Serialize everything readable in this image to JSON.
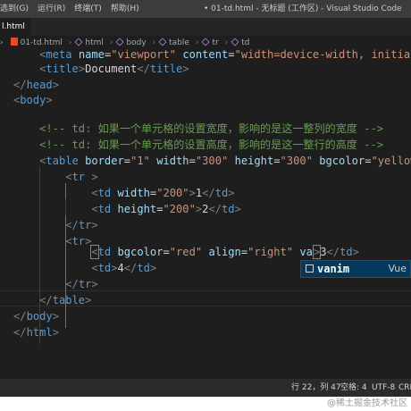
{
  "window": {
    "menu": [
      "选到(G)",
      "运行(R)",
      "终端(T)",
      "帮助(H)"
    ],
    "title": "• 01-td.html - 无标题 (工作区) - Visual Studio Code"
  },
  "tab": {
    "label": "l.html"
  },
  "breadcrumb": {
    "file": "01-td.html",
    "items": [
      "html",
      "body",
      "table",
      "tr",
      "td"
    ],
    "leading_sep": "›"
  },
  "code": {
    "l0": {
      "lead": "    ",
      "open": "<",
      "tag": "meta",
      "attr1": "name",
      "eq1": "=",
      "val1": "\"viewport\"",
      "attr2": "content",
      "eq2": "=",
      "val2": "\"width=device-width, initial-s"
    },
    "l1": {
      "lead": "    ",
      "o1": "<",
      "tag1": "title",
      "c1": ">",
      "text": "Document",
      "o2": "</",
      "tag2": "title",
      "c2": ">"
    },
    "l2": {
      "o": "</",
      "tag": "head",
      "c": ">"
    },
    "l3": {
      "o": "<",
      "tag": "body",
      "c": ">"
    },
    "l5": "    <!-- td: 如果一个单元格的设置宽度，影响的是这一整列的宽度 -->",
    "l6": "    <!-- td: 如果一个单元格的设置高度，影响的是这一整行的高度 -->",
    "l7": {
      "lead": "    ",
      "o": "<",
      "tag": "table",
      "attr1": "border",
      "eq1": "=",
      "val1": "\"1\"",
      "attr2": "width",
      "eq2": "=",
      "val2": "\"300\"",
      "attr3": "height",
      "eq3": "=",
      "val3": "\"300\"",
      "attr4": "bgcolor",
      "eq4": "=",
      "val4": "\"yellow\""
    },
    "l8": {
      "lead": "        ",
      "o": "<",
      "tag": "tr",
      "c": " >"
    },
    "l9": {
      "lead": "            ",
      "o1": "<",
      "tag1": "td",
      "attr": "width",
      "eq": "=",
      "val": "\"200\"",
      "c1": ">",
      "text": "1",
      "o2": "</",
      "tag2": "td",
      "c2": ">"
    },
    "l10": {
      "lead": "            ",
      "o1": "<",
      "tag1": "td",
      "attr": "height",
      "eq": "=",
      "val": "\"200\"",
      "c1": ">",
      "text": "2",
      "o2": "</",
      "tag2": "td",
      "c2": ">"
    },
    "l11": {
      "lead": "        ",
      "o": "</",
      "tag": "tr",
      "c": ">"
    },
    "l12": {
      "lead": "        ",
      "o": "<",
      "tag": "tr",
      "c": ">"
    },
    "l13": {
      "lead": "            ",
      "o1": "<",
      "tag1": "td",
      "attr1": "bgcolor",
      "eq1": "=",
      "val1": "\"red\"",
      "attr2": "align",
      "eq2": "=",
      "val2": "\"right\"",
      "typed": "va",
      "c1": ">",
      "text": "3",
      "o2": "</",
      "tag2": "td",
      "c2": ">"
    },
    "l14": {
      "lead": "            ",
      "o1": "<",
      "tag1": "td",
      "c1": ">",
      "text": "4",
      "o2": "</",
      "tag2": "td",
      "c2": ">"
    },
    "l15": {
      "lead": "        ",
      "o": "</",
      "tag": "tr",
      "c": ">"
    },
    "l16": {
      "lead": "    ",
      "o": "</",
      "tag": "table",
      "c": ">"
    },
    "l17": {
      "o": "</",
      "tag": "body",
      "c": ">"
    },
    "l18": {
      "o": "</",
      "tag": "html",
      "c": ">"
    }
  },
  "suggestion": {
    "label": "vanim",
    "detail": "Vue",
    "icon": "snippet-icon"
  },
  "status": {
    "position": "行 22，列 47",
    "indent": "空格: 4",
    "encoding": "UTF-8",
    "eol": "CRLF"
  },
  "watermark": "@稀土掘金技术社区",
  "colors": {
    "tag": "#569cd6",
    "attr": "#9cdcfe",
    "string": "#ce9178",
    "comment": "#6a9955",
    "punct": "#808080",
    "text": "#d4d4d4",
    "background": "#1e1e1e"
  }
}
